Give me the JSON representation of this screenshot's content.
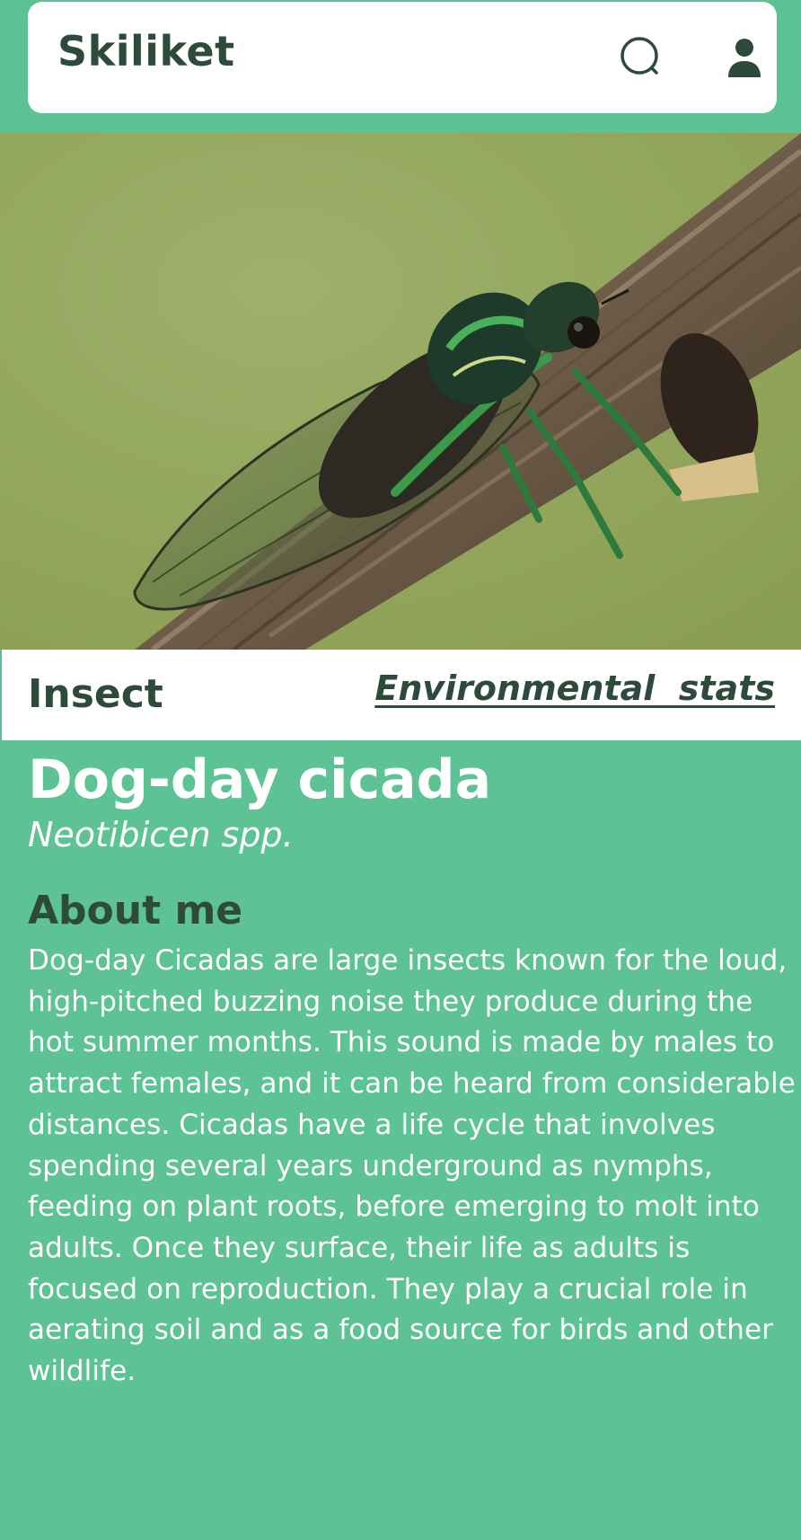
{
  "header": {
    "title": "Skiliket",
    "search_icon": "search-icon",
    "profile_icon": "user-icon"
  },
  "hero": {
    "subject": "cicada-on-branch-photo"
  },
  "species": {
    "category": "Insect",
    "stats_link": "Environmental  stats",
    "common_name": "Dog-day cicada",
    "scientific_name": "Neotibicen spp."
  },
  "about": {
    "heading": "About me",
    "text": "Dog-day Cicadas are large insects known for the loud, high-pitched buzzing noise they produce during the hot summer months. This sound is made by males to attract females, and it can be heard from considerable distances. Cicadas have a life cycle that involves spending several years underground as nymphs, feeding on plant roots, before emerging to molt into adults. Once they surface, their life as adults is  focused on reproduction. They play a crucial role in aerating soil and as a food source for birds and other wildlife."
  },
  "colors": {
    "background": "#5dc294",
    "dark_text": "#2d4a3b",
    "light_text": "#ffffff",
    "card": "#ffffff"
  }
}
